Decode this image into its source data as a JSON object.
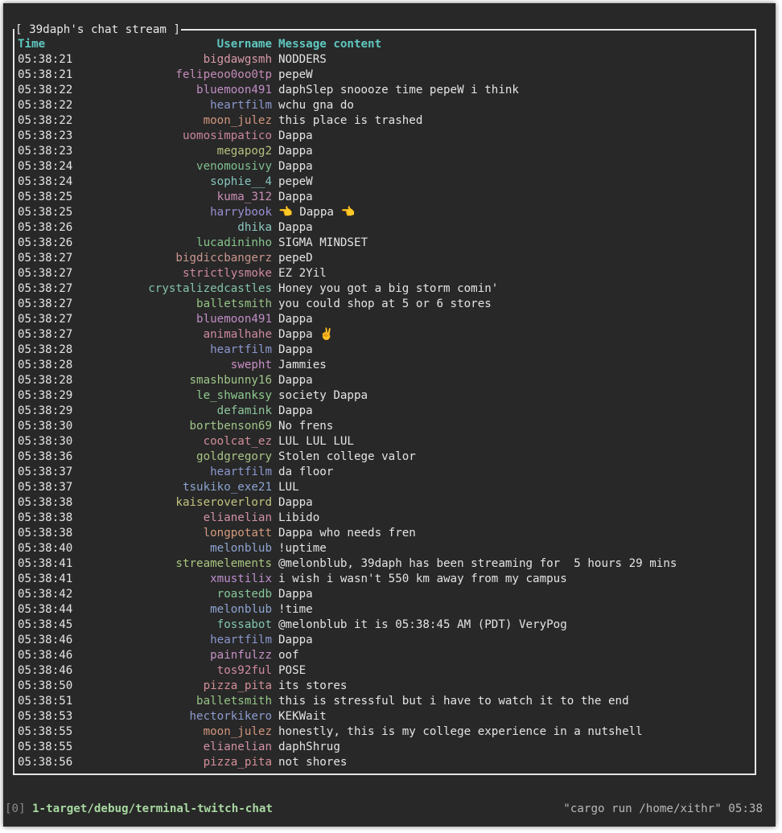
{
  "window": {
    "frame_title": "[ 39daph's chat stream ]"
  },
  "table": {
    "headers": {
      "time": "Time",
      "username": "Username",
      "message": "Message content"
    },
    "rows": [
      {
        "time": "05:38:21",
        "user": "bigdawgsmh",
        "color": "#d79aa8",
        "msg": "NODDERS"
      },
      {
        "time": "05:38:21",
        "user": "felipeoo0oo0tp",
        "color": "#c48bb7",
        "msg": "pepeW"
      },
      {
        "time": "05:38:22",
        "user": "bluemoon491",
        "color": "#c08ec6",
        "msg": "daphSlep snoooze time pepeW i think"
      },
      {
        "time": "05:38:22",
        "user": "heartfilm",
        "color": "#8b97cf",
        "msg": "wchu gna do"
      },
      {
        "time": "05:38:22",
        "user": "moon_julez",
        "color": "#d2967e",
        "msg": "this place is trashed"
      },
      {
        "time": "05:38:23",
        "user": "uomosimpatico",
        "color": "#c8859a",
        "msg": "Dappa"
      },
      {
        "time": "05:38:23",
        "user": "megapog2",
        "color": "#b3c17d",
        "msg": "Dappa"
      },
      {
        "time": "05:38:24",
        "user": "venomousivy",
        "color": "#7fbf8f",
        "msg": "Dappa"
      },
      {
        "time": "05:38:24",
        "user": "sophie__4",
        "color": "#86c4bd",
        "msg": "pepeW"
      },
      {
        "time": "05:38:25",
        "user": "kuma_312",
        "color": "#c98fb6",
        "msg": "Dappa"
      },
      {
        "time": "05:38:25",
        "user": "harrybook",
        "color": "#9b8fd3",
        "msg": "👈 Dappa 👈"
      },
      {
        "time": "05:38:26",
        "user": "dhika",
        "color": "#8cc9bf",
        "msg": "Dappa"
      },
      {
        "time": "05:38:26",
        "user": "lucadininho",
        "color": "#86c48c",
        "msg": "SIGMA MINDSET"
      },
      {
        "time": "05:38:27",
        "user": "bigdiccbangerz",
        "color": "#c9958f",
        "msg": "pepeD"
      },
      {
        "time": "05:38:27",
        "user": "strictlysmoke",
        "color": "#d08a9f",
        "msg": "EZ 2Yil"
      },
      {
        "time": "05:38:27",
        "user": "crystalizedcastles",
        "color": "#84c4a8",
        "msg": "Honey you got a big storm comin'"
      },
      {
        "time": "05:38:27",
        "user": "balletsmith",
        "color": "#95c486",
        "msg": "you could shop at 5 or 6 stores"
      },
      {
        "time": "05:38:27",
        "user": "bluemoon491",
        "color": "#c08ec6",
        "msg": "Dappa"
      },
      {
        "time": "05:38:27",
        "user": "animalhahe",
        "color": "#cf8aa2",
        "msg": "Dappa ✌️"
      },
      {
        "time": "05:38:28",
        "user": "heartfilm",
        "color": "#8b97cf",
        "msg": "Dappa"
      },
      {
        "time": "05:38:28",
        "user": "swepht",
        "color": "#c98fc5",
        "msg": "Jammies"
      },
      {
        "time": "05:38:28",
        "user": "smashbunny16",
        "color": "#9ec688",
        "msg": "Dappa"
      },
      {
        "time": "05:38:29",
        "user": "le_shwanksy",
        "color": "#8ec98e",
        "msg": "society Dappa"
      },
      {
        "time": "05:38:29",
        "user": "defamink",
        "color": "#8cc69c",
        "msg": "Dappa"
      },
      {
        "time": "05:38:30",
        "user": "bortbenson69",
        "color": "#9fc58a",
        "msg": "No frens"
      },
      {
        "time": "05:38:30",
        "user": "coolcat_ez",
        "color": "#d08e9a",
        "msg": "LUL LUL LUL"
      },
      {
        "time": "05:38:36",
        "user": "goldgregory",
        "color": "#a7c686",
        "msg": "Stolen college valor"
      },
      {
        "time": "05:38:37",
        "user": "heartfilm",
        "color": "#8b97cf",
        "msg": "da floor"
      },
      {
        "time": "05:38:37",
        "user": "tsukiko_exe21",
        "color": "#8aa3cf",
        "msg": "LUL"
      },
      {
        "time": "05:38:38",
        "user": "kaiseroverlord",
        "color": "#c2c27e",
        "msg": "Dappa"
      },
      {
        "time": "05:38:38",
        "user": "elianelian",
        "color": "#d091a3",
        "msg": "Libido"
      },
      {
        "time": "05:38:38",
        "user": "longpotatt",
        "color": "#d49a7f",
        "msg": "Dappa who needs fren"
      },
      {
        "time": "05:38:40",
        "user": "melonblub",
        "color": "#8ea4d2",
        "msg": "!uptime"
      },
      {
        "time": "05:38:41",
        "user": "streamelements",
        "color": "#a9c67f",
        "msg": "@melonblub, 39daph has been streaming for  5 hours 29 mins"
      },
      {
        "time": "05:38:41",
        "user": "xmustilix",
        "color": "#bf8fcf",
        "msg": "i wish i wasn't 550 km away from my campus"
      },
      {
        "time": "05:38:42",
        "user": "roastedb",
        "color": "#86c69a",
        "msg": "Dappa"
      },
      {
        "time": "05:38:44",
        "user": "melonblub",
        "color": "#8ea4d2",
        "msg": "!time"
      },
      {
        "time": "05:38:45",
        "user": "fossabot",
        "color": "#82c7ae",
        "msg": "@melonblub it is 05:38:45 AM (PDT) VeryPog"
      },
      {
        "time": "05:38:46",
        "user": "heartfilm",
        "color": "#8b97cf",
        "msg": "Dappa"
      },
      {
        "time": "05:38:46",
        "user": "painfulzz",
        "color": "#c692c6",
        "msg": "oof"
      },
      {
        "time": "05:38:46",
        "user": "tos92ful",
        "color": "#d08aa5",
        "msg": "POSE"
      },
      {
        "time": "05:38:50",
        "user": "pizza_pita",
        "color": "#d48f98",
        "msg": "its stores"
      },
      {
        "time": "05:38:51",
        "user": "balletsmith",
        "color": "#95c486",
        "msg": "this is stressful but i have to watch it to the end"
      },
      {
        "time": "05:38:53",
        "user": "hectorkikero",
        "color": "#8c9ccf",
        "msg": "KEKWait"
      },
      {
        "time": "05:38:55",
        "user": "moon_julez",
        "color": "#d2967e",
        "msg": "honestly, this is my college experience in a nutshell"
      },
      {
        "time": "05:38:55",
        "user": "elianelian",
        "color": "#d091a3",
        "msg": "daphShrug"
      },
      {
        "time": "05:38:56",
        "user": "pizza_pita",
        "color": "#d48f98",
        "msg": "not shores"
      }
    ]
  },
  "statusbar": {
    "index": "[0]",
    "command": "1-target/debug/terminal-twitch-chat",
    "right": "\"cargo run /home/xithr\" 05:38"
  },
  "colors": {
    "background": "#282828",
    "header": "#5fc7c0",
    "text": "#e4e4e4",
    "border": "#e6e6e6"
  }
}
